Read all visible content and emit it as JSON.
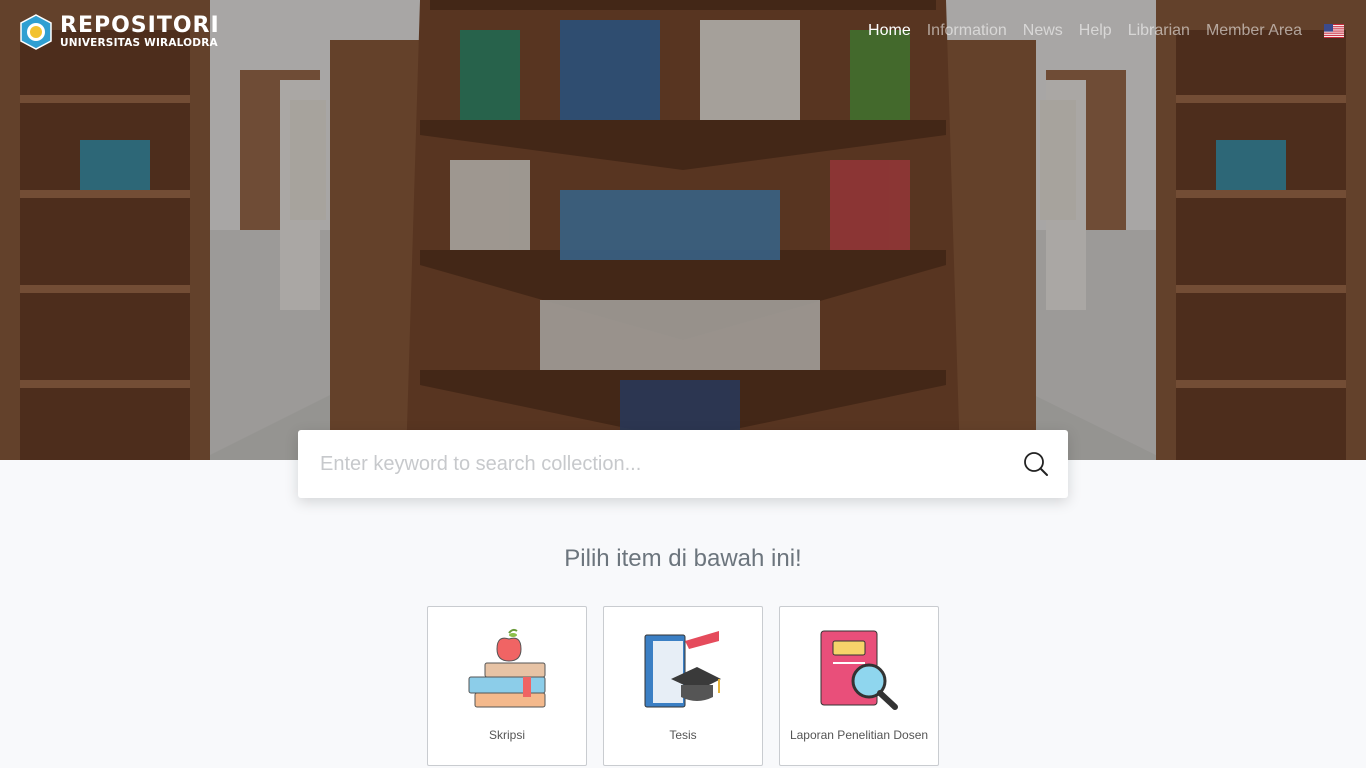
{
  "header": {
    "brand_title": "REPOSITORI",
    "brand_subtitle": "UNIVERSITAS WIRALODRA",
    "nav": [
      {
        "label": "Home",
        "active": true
      },
      {
        "label": "Information",
        "active": false
      },
      {
        "label": "News",
        "active": false
      },
      {
        "label": "Help",
        "active": false
      },
      {
        "label": "Librarian",
        "active": false
      },
      {
        "label": "Member Area",
        "active": false
      }
    ],
    "language_icon": "us-flag-icon"
  },
  "search": {
    "placeholder": "Enter keyword to search collection...",
    "value": "",
    "icon": "search-icon"
  },
  "main": {
    "heading": "Pilih item di bawah ini!",
    "items": [
      {
        "label": "Skripsi",
        "icon": "books-apple-icon"
      },
      {
        "label": "Tesis",
        "icon": "thesis-book-icon"
      },
      {
        "label": "Laporan Penelitian Dosen",
        "icon": "report-magnifier-icon"
      }
    ]
  },
  "colors": {
    "background": "#f8f9fb",
    "heading_text": "#6c757d",
    "nav_active": "#ffffff"
  }
}
